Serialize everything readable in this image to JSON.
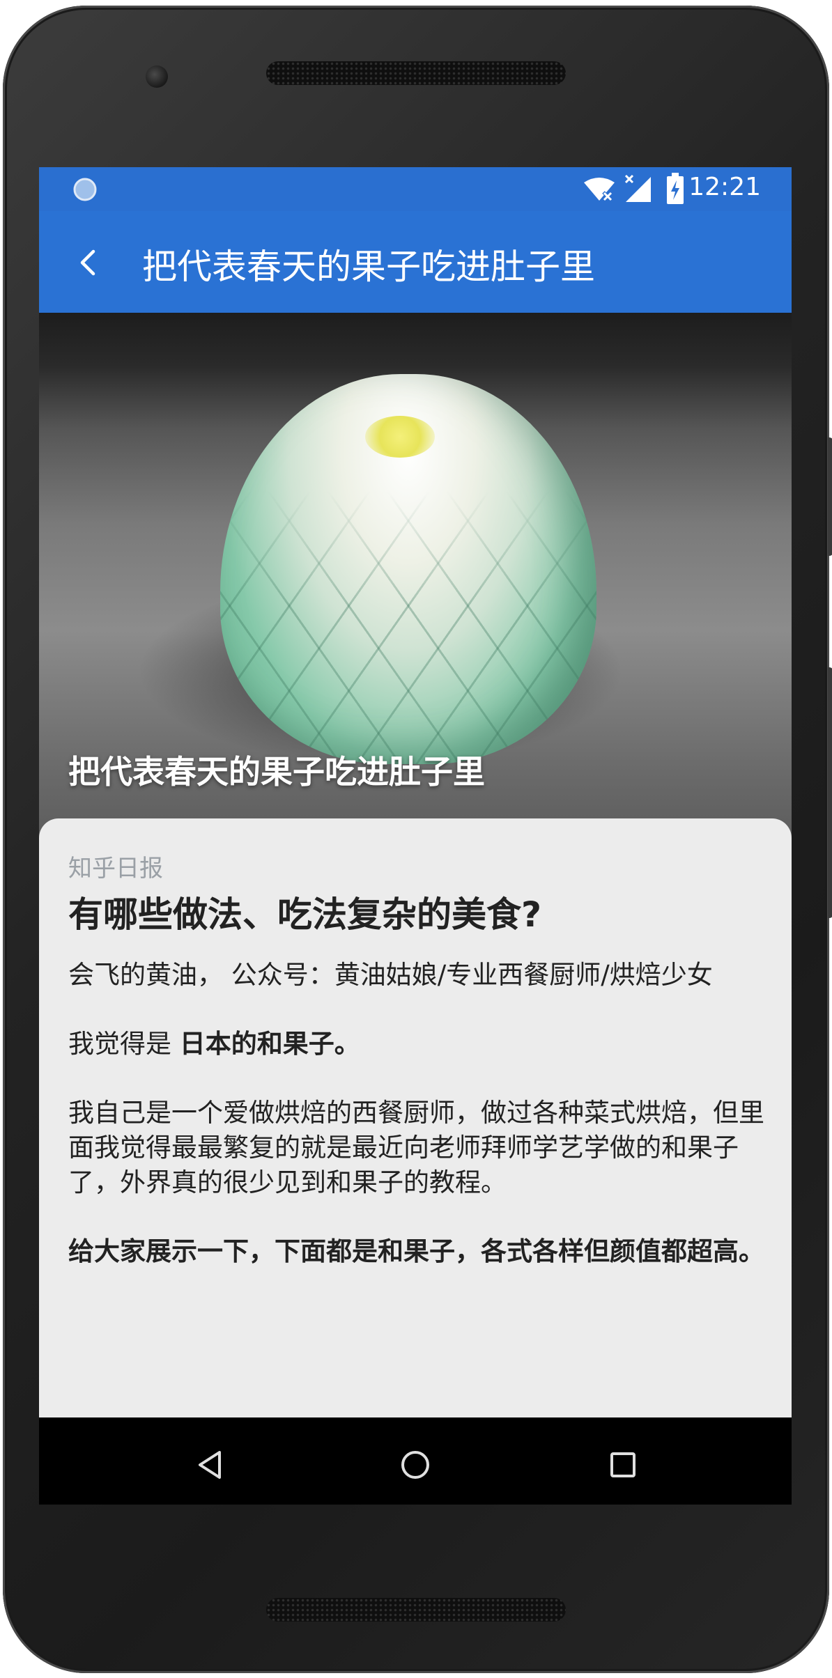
{
  "statusbar": {
    "time": "12:21",
    "icons": [
      "notification-circle-icon",
      "wifi-off-icon",
      "signal-icon",
      "battery-charging-icon"
    ]
  },
  "appbar": {
    "back_icon": "chevron-left-icon",
    "title": "把代表春天的果子吃进肚子里"
  },
  "hero": {
    "caption": "把代表春天的果子吃进肚子里"
  },
  "article": {
    "source": "知乎日报",
    "question": "有哪些做法、吃法复杂的美食?",
    "author_line": "会飞的黄油， 公众号：黄油姑娘/专业西餐厨师/烘焙少女",
    "para1_prefix": "我觉得是 ",
    "para1_bold": "日本的和果子。",
    "para2": "我自己是一个爱做烘焙的西餐厨师，做过各种菜式烘焙，但里面我觉得最最繁复的就是最近向老师拜师学艺学做的和果子了，外界真的很少见到和果子的教程。",
    "para3": "给大家展示一下，下面都是和果子，各式各样但颜值都超高。"
  },
  "navbar": {
    "back": "triangle-back-icon",
    "home": "circle-home-icon",
    "recents": "square-recents-icon"
  },
  "colors": {
    "statusbar": "#2a6fd0",
    "appbar": "#2a72d4",
    "card": "#ececec",
    "source_text": "#9aa0a6"
  }
}
